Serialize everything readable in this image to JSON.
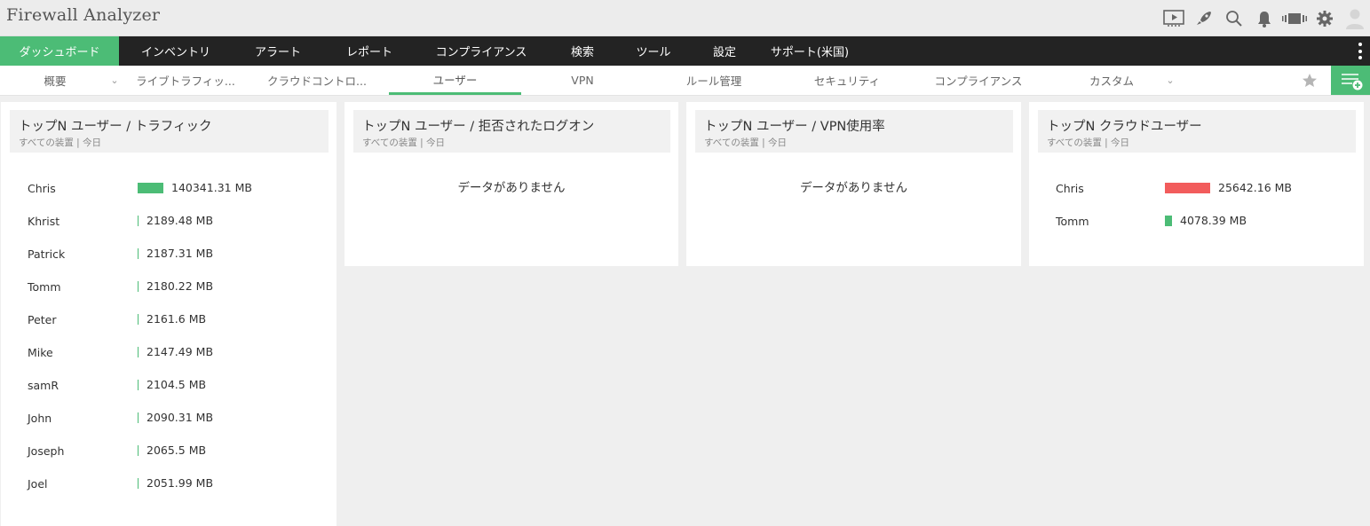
{
  "app": {
    "title": "Firewall Analyzer"
  },
  "colors": {
    "accent": "#4cbc76",
    "nav_bg": "#232323",
    "bar_green": "#4cbc76",
    "bar_red": "#f25c5c"
  },
  "top_icons": [
    "presentation-icon",
    "rocket-icon",
    "search-icon",
    "bell-icon",
    "battery-icon",
    "gear-icon",
    "user-avatar-icon"
  ],
  "main_nav": {
    "items": [
      {
        "label": "ダッシュボード",
        "active": true
      },
      {
        "label": "インベントリ"
      },
      {
        "label": "アラート"
      },
      {
        "label": "レポート"
      },
      {
        "label": "コンプライアンス"
      },
      {
        "label": "検索"
      },
      {
        "label": "ツール"
      },
      {
        "label": "設定"
      },
      {
        "label": "サポート(米国)"
      }
    ]
  },
  "sub_nav": {
    "tabs": [
      {
        "label": "概要"
      },
      {
        "label": "ライブトラフィッ..."
      },
      {
        "label": "クラウドコントロ..."
      },
      {
        "label": "ユーザー",
        "active": true
      },
      {
        "label": "VPN"
      },
      {
        "label": "ルール管理"
      },
      {
        "label": "セキュリティ"
      },
      {
        "label": "コンプライアンス"
      },
      {
        "label": "カスタム"
      }
    ]
  },
  "widgets": {
    "traffic": {
      "title": "トップN ユーザー / トラフィック",
      "subtitle": "すべての装置 | 今日",
      "max_value": 140341.31,
      "rows": [
        {
          "name": "Chris",
          "value": 140341.31,
          "label": "140341.31 MB"
        },
        {
          "name": "Khrist",
          "value": 2189.48,
          "label": "2189.48 MB"
        },
        {
          "name": "Patrick",
          "value": 2187.31,
          "label": "2187.31 MB"
        },
        {
          "name": "Tomm",
          "value": 2180.22,
          "label": "2180.22 MB"
        },
        {
          "name": "Peter",
          "value": 2161.6,
          "label": "2161.6 MB"
        },
        {
          "name": "Mike",
          "value": 2147.49,
          "label": "2147.49 MB"
        },
        {
          "name": "samR",
          "value": 2104.5,
          "label": "2104.5 MB"
        },
        {
          "name": "John",
          "value": 2090.31,
          "label": "2090.31 MB"
        },
        {
          "name": "Joseph",
          "value": 2065.5,
          "label": "2065.5 MB"
        },
        {
          "name": "Joel",
          "value": 2051.99,
          "label": "2051.99 MB"
        }
      ]
    },
    "denied": {
      "title": "トップN ユーザー / 拒否されたログオン",
      "subtitle": "すべての装置 | 今日",
      "empty_text": "データがありません"
    },
    "vpn": {
      "title": "トップN ユーザー / VPN使用率",
      "subtitle": "すべての装置 | 今日",
      "empty_text": "データがありません"
    },
    "cloud": {
      "title": "トップN クラウドユーザー",
      "subtitle": "すべての装置 | 今日",
      "max_value": 25642.16,
      "rows": [
        {
          "name": "Chris",
          "value": 25642.16,
          "label": "25642.16 MB",
          "color": "#f25c5c"
        },
        {
          "name": "Tomm",
          "value": 4078.39,
          "label": "4078.39 MB",
          "color": "#4cbc76"
        }
      ]
    }
  }
}
